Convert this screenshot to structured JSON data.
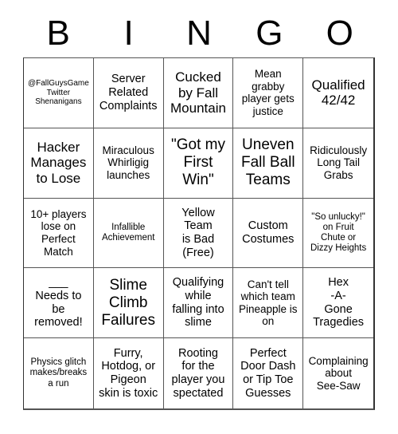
{
  "header": {
    "letters": [
      "B",
      "I",
      "N",
      "G",
      "O"
    ]
  },
  "cells": [
    [
      "@FallGuysGame\nTwitter\nShenanigans",
      "Server\nRelated\nComplaints",
      "Cucked\nby Fall\nMountain",
      "Mean\ngrabby\nplayer gets\njustice",
      "Qualified\n42/42"
    ],
    [
      "Hacker\nManages\nto Lose",
      "Miraculous\nWhirligig\nlaunches",
      "\"Got my\nFirst\nWin\"",
      "Uneven\nFall Ball\nTeams",
      "Ridiculously\nLong Tail\nGrabs"
    ],
    [
      "10+ players\nlose on\nPerfect\nMatch",
      "Infallible\nAchievement",
      "Yellow\nTeam\nis Bad\n(Free)",
      "Custom\nCostumes",
      "\"So unlucky!\"\non Fruit\nChute or\nDizzy Heights"
    ],
    [
      "___\nNeeds to\nbe\nremoved!",
      "Slime\nClimb\nFailures",
      "Qualifying\nwhile\nfalling into\nslime",
      "Can't tell\nwhich team\nPineapple is\non",
      "Hex\n-A-\nGone\nTragedies"
    ],
    [
      "Physics glitch\nmakes/breaks\na run",
      "Furry,\nHotdog, or\nPigeon\nskin is toxic",
      "Rooting\nfor the\nplayer you\nspectated",
      "Perfect\nDoor Dash\nor Tip Toe\nGuesses",
      "Complaining\nabout\nSee-Saw"
    ]
  ],
  "free_space": {
    "row": 2,
    "col": 2,
    "label": "Yellow Team is Bad (Free)"
  },
  "colors": {
    "background": "#ffffff",
    "text": "#000000",
    "grid_line": "#555555"
  }
}
